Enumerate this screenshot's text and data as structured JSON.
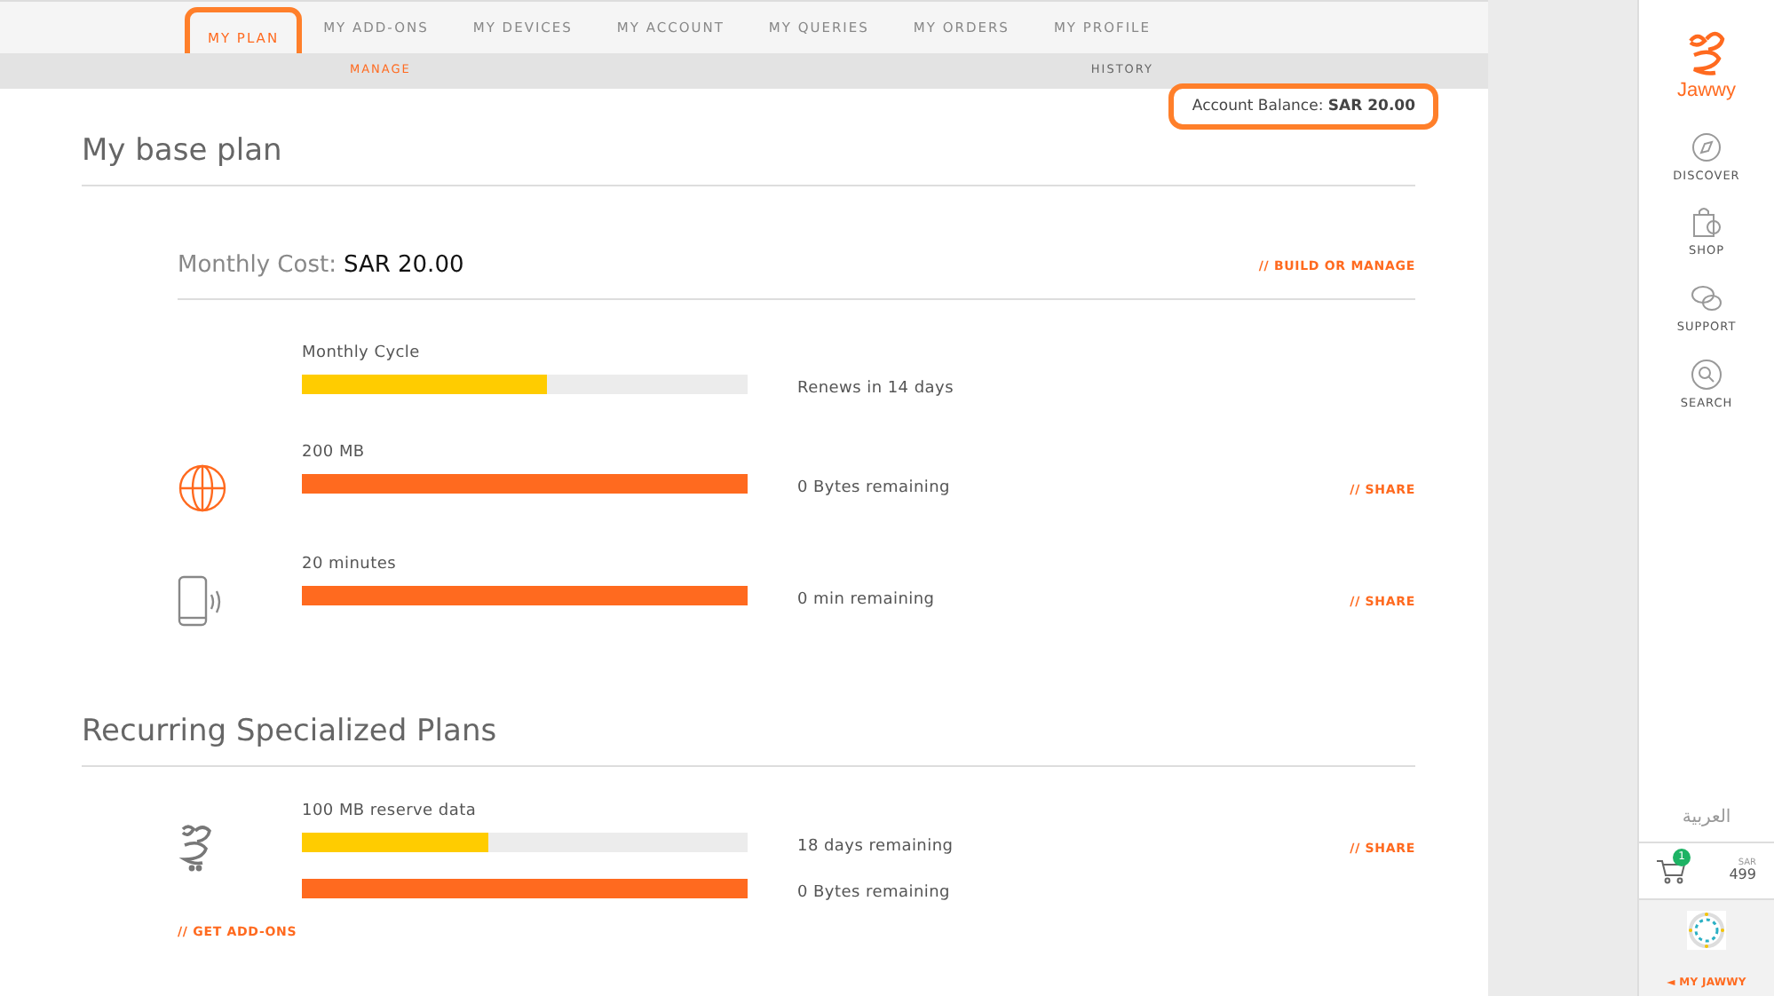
{
  "nav": {
    "tabs": [
      {
        "label": "MY PLAN",
        "selected": true
      },
      {
        "label": "MY ADD-ONS",
        "selected": false
      },
      {
        "label": "MY DEVICES",
        "selected": false
      },
      {
        "label": "MY ACCOUNT",
        "selected": false
      },
      {
        "label": "MY QUERIES",
        "selected": false
      },
      {
        "label": "MY ORDERS",
        "selected": false
      },
      {
        "label": "MY PROFILE",
        "selected": false
      }
    ],
    "subtabs": [
      {
        "label": "MANAGE",
        "selected": true
      },
      {
        "label": "HISTORY",
        "selected": false
      }
    ]
  },
  "account_balance": {
    "label": "Account Balance:",
    "value": "SAR 20.00"
  },
  "base_plan": {
    "title": "My base plan",
    "cost_label": "Monthly Cost:",
    "cost_value": "SAR 20.00",
    "action": "// BUILD OR MANAGE",
    "rows": [
      {
        "kind": "none",
        "label": "Monthly Cycle",
        "bars": [
          {
            "level": 0.55,
            "color": "#ffcc00",
            "reading": "Renews in 14 days"
          }
        ]
      },
      {
        "kind": "globe",
        "label": "200 MB",
        "bars": [
          {
            "level": 1,
            "color": "#ff6a1f",
            "reading": "0 Bytes remaining"
          }
        ],
        "share": "// SHARE"
      },
      {
        "kind": "phone",
        "label": "20 minutes",
        "bars": [
          {
            "level": 1,
            "color": "#ff6a1f",
            "reading": "0 min remaining"
          }
        ],
        "share": "// SHARE"
      }
    ]
  },
  "specialized": {
    "title": "Recurring Specialized Plans",
    "rows": [
      {
        "kind": "logo",
        "label": "100 MB reserve data",
        "bars": [
          {
            "level": 0.42,
            "color": "#ffcc00",
            "reading": "18 days remaining"
          },
          {
            "level": 1,
            "color": "#ff6a1f",
            "reading": "0 Bytes remaining"
          }
        ],
        "share": "// SHARE"
      }
    ],
    "action": "// GET ADD-ONS"
  },
  "sidebar": {
    "logo_text": "Jawwy",
    "items": [
      {
        "kind": "discover",
        "label": "DISCOVER"
      },
      {
        "kind": "shop",
        "label": "SHOP"
      },
      {
        "kind": "support",
        "label": "SUPPORT"
      },
      {
        "kind": "search",
        "label": "SEARCH"
      }
    ],
    "language": "العربية",
    "cart": {
      "count": "1",
      "currency": "SAR",
      "amount": "499"
    },
    "back_link": "◄ MY JAWWY"
  }
}
